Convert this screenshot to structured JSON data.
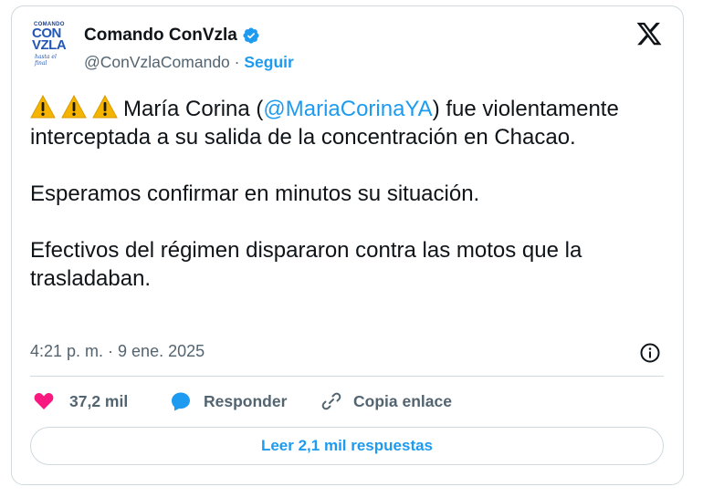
{
  "account": {
    "name": "Comando ConVzla",
    "handle": "@ConVzlaComando",
    "separator": "·",
    "follow_label": "Seguir",
    "avatar_text": {
      "top": "COMANDO",
      "line1": "CON",
      "line2": "VZLA",
      "tagline": "hasta el final"
    }
  },
  "tweet": {
    "line1_prefix": "María Corina (",
    "mention": "@MariaCorinaYA",
    "line1_suffix": ") fue violentamente interceptada a su salida de la concentración en Chacao.",
    "paragraph2": "Esperamos confirmar en minutos su situación.",
    "paragraph3": "Efectivos del régimen dispararon contra las motos que la trasladaban.",
    "timestamp": "4:21 p. m. · 9 ene. 2025"
  },
  "actions": {
    "likes": "37,2 mil",
    "reply_label": "Responder",
    "copy_label": "Copia enlace"
  },
  "replies_button": "Leer 2,1 mil respuestas",
  "colors": {
    "accent": "#1d9bf0",
    "like": "#f91880",
    "muted": "#536471",
    "warning": "#f5b400"
  },
  "icons": [
    "verified-badge-icon",
    "x-logo-icon",
    "warning-icon",
    "info-icon",
    "heart-icon",
    "reply-bubble-icon",
    "link-icon"
  ]
}
